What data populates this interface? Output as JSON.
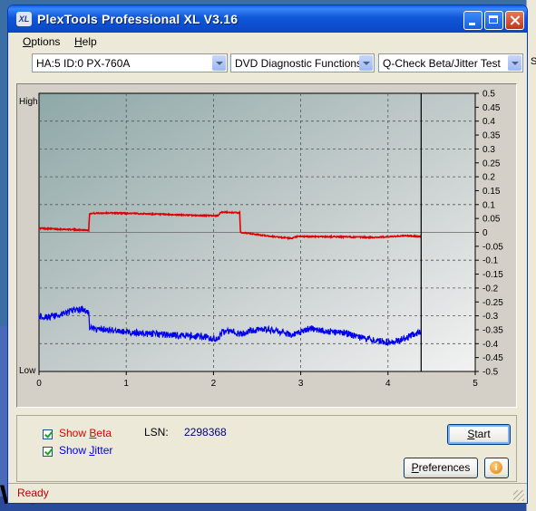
{
  "window": {
    "title": "PlexTools Professional XL V3.16",
    "icon_text": "XL",
    "accent": "#0a5fe8"
  },
  "menu": {
    "items": [
      {
        "label": "Options",
        "mnemonic": "O"
      },
      {
        "label": "Help",
        "mnemonic": "H"
      }
    ]
  },
  "toolbar": {
    "drive": "HA:5 ID:0  PX-760A",
    "function": "DVD Diagnostic Functions",
    "test": "Q-Check Beta/Jitter Test"
  },
  "chart_data": {
    "type": "line",
    "left_axis_labels": {
      "top": "High",
      "bottom": "Low"
    },
    "xlim": [
      0,
      5
    ],
    "ylim": [
      -0.5,
      0.5
    ],
    "x_ticks": [
      "0",
      "1",
      "2",
      "3",
      "4",
      "5"
    ],
    "y_ticks": [
      "0.5",
      "0.45",
      "0.4",
      "0.35",
      "0.3",
      "0.25",
      "0.2",
      "0.15",
      "0.1",
      "0.05",
      "0",
      "-0.05",
      "-0.1",
      "-0.15",
      "-0.2",
      "-0.25",
      "-0.3",
      "-0.35",
      "-0.4",
      "-0.45",
      "-0.5"
    ],
    "grid": true,
    "cursor_x": 4.38,
    "series": [
      {
        "name": "Beta",
        "color": "#e00000",
        "x": [
          0.0,
          0.2,
          0.4,
          0.57,
          0.58,
          0.8,
          1.0,
          1.2,
          1.5,
          1.8,
          2.05,
          2.08,
          2.2,
          2.3,
          2.31,
          2.6,
          2.9,
          2.95,
          3.2,
          3.5,
          3.8,
          4.0,
          4.2,
          4.38
        ],
        "y": [
          0.015,
          0.012,
          0.01,
          0.008,
          0.068,
          0.07,
          0.069,
          0.067,
          0.064,
          0.061,
          0.06,
          0.072,
          0.072,
          0.07,
          0.0,
          -0.012,
          -0.022,
          -0.015,
          -0.015,
          -0.016,
          -0.018,
          -0.016,
          -0.012,
          -0.015
        ]
      },
      {
        "name": "Jitter",
        "color": "#0000ee",
        "x": [
          0.0,
          0.1,
          0.2,
          0.3,
          0.4,
          0.5,
          0.57,
          0.58,
          0.7,
          0.9,
          1.1,
          1.3,
          1.5,
          1.7,
          1.9,
          2.05,
          2.1,
          2.2,
          2.3,
          2.4,
          2.5,
          2.6,
          2.7,
          2.8,
          2.9,
          3.0,
          3.1,
          3.2,
          3.3,
          3.4,
          3.5,
          3.6,
          3.7,
          3.8,
          3.9,
          4.0,
          4.1,
          4.2,
          4.3,
          4.38
        ],
        "y": [
          -0.3,
          -0.305,
          -0.3,
          -0.29,
          -0.28,
          -0.275,
          -0.29,
          -0.345,
          -0.35,
          -0.355,
          -0.36,
          -0.365,
          -0.37,
          -0.372,
          -0.375,
          -0.385,
          -0.36,
          -0.355,
          -0.365,
          -0.355,
          -0.35,
          -0.35,
          -0.352,
          -0.36,
          -0.37,
          -0.36,
          -0.345,
          -0.35,
          -0.355,
          -0.36,
          -0.36,
          -0.37,
          -0.38,
          -0.385,
          -0.39,
          -0.395,
          -0.39,
          -0.38,
          -0.365,
          -0.36
        ]
      }
    ]
  },
  "controls": {
    "show_beta": {
      "label": "Show Beta",
      "mnemonic": "B",
      "checked": true,
      "color": "#e00000"
    },
    "show_jitter": {
      "label": "Show Jitter",
      "mnemonic": "J",
      "checked": true,
      "color": "#0000ee"
    },
    "lsn_label": "LSN:",
    "lsn_value": "2298368",
    "start_label": "Start",
    "preferences_label": "Preferences",
    "info_symbol": "i"
  },
  "status": {
    "text": "Ready"
  }
}
